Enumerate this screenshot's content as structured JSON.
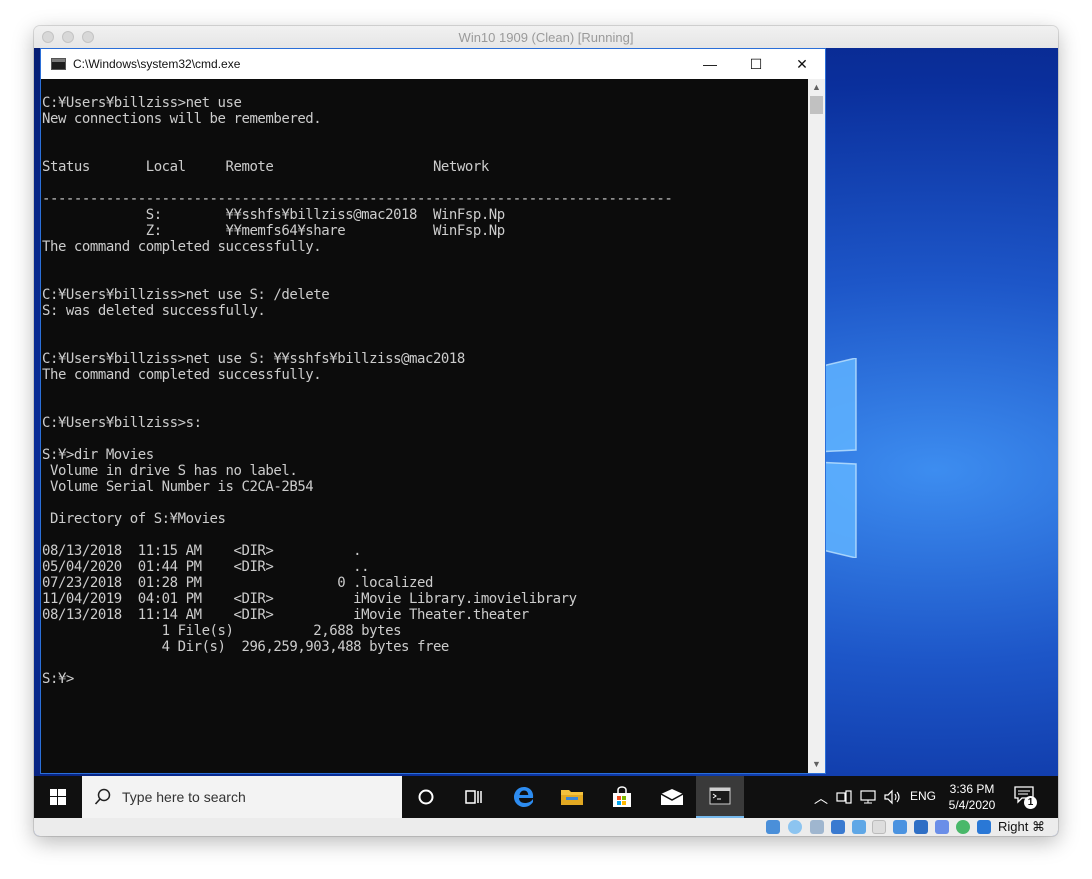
{
  "vm": {
    "title": "Win10 1909 (Clean) [Running]"
  },
  "cmd": {
    "title": "C:\\Windows\\system32\\cmd.exe",
    "minimize": "—",
    "maximize": "☐",
    "close": "✕",
    "lines": [
      "C:¥Users¥billziss>net use",
      "New connections will be remembered.",
      "",
      "",
      "Status       Local     Remote                    Network",
      "",
      "-------------------------------------------------------------------------------",
      "             S:        ¥¥sshfs¥billziss@mac2018  WinFsp.Np",
      "             Z:        ¥¥memfs64¥share           WinFsp.Np",
      "The command completed successfully.",
      "",
      "",
      "C:¥Users¥billziss>net use S: /delete",
      "S: was deleted successfully.",
      "",
      "",
      "C:¥Users¥billziss>net use S: ¥¥sshfs¥billziss@mac2018",
      "The command completed successfully.",
      "",
      "",
      "C:¥Users¥billziss>s:",
      "",
      "S:¥>dir Movies",
      " Volume in drive S has no label.",
      " Volume Serial Number is C2CA-2B54",
      "",
      " Directory of S:¥Movies",
      "",
      "08/13/2018  11:15 AM    <DIR>          .",
      "05/04/2020  01:44 PM    <DIR>          ..",
      "07/23/2018  01:28 PM                 0 .localized",
      "11/04/2019  04:01 PM    <DIR>          iMovie Library.imovielibrary",
      "08/13/2018  11:14 AM    <DIR>          iMovie Theater.theater",
      "               1 File(s)          2,688 bytes",
      "               4 Dir(s)  296,259,903,488 bytes free",
      "",
      "S:¥>"
    ]
  },
  "taskbar": {
    "search_placeholder": "Type here to search",
    "tray": {
      "language": "ENG",
      "time": "3:36 PM",
      "date": "5/4/2020",
      "notification_count": "1"
    }
  },
  "vbox_status": {
    "host_key": "Right ⌘"
  },
  "colors": {
    "desktop": "#0a2f9c",
    "console_bg": "#0c0c0c",
    "console_fg": "#cccccc",
    "taskbar": "#101010"
  }
}
